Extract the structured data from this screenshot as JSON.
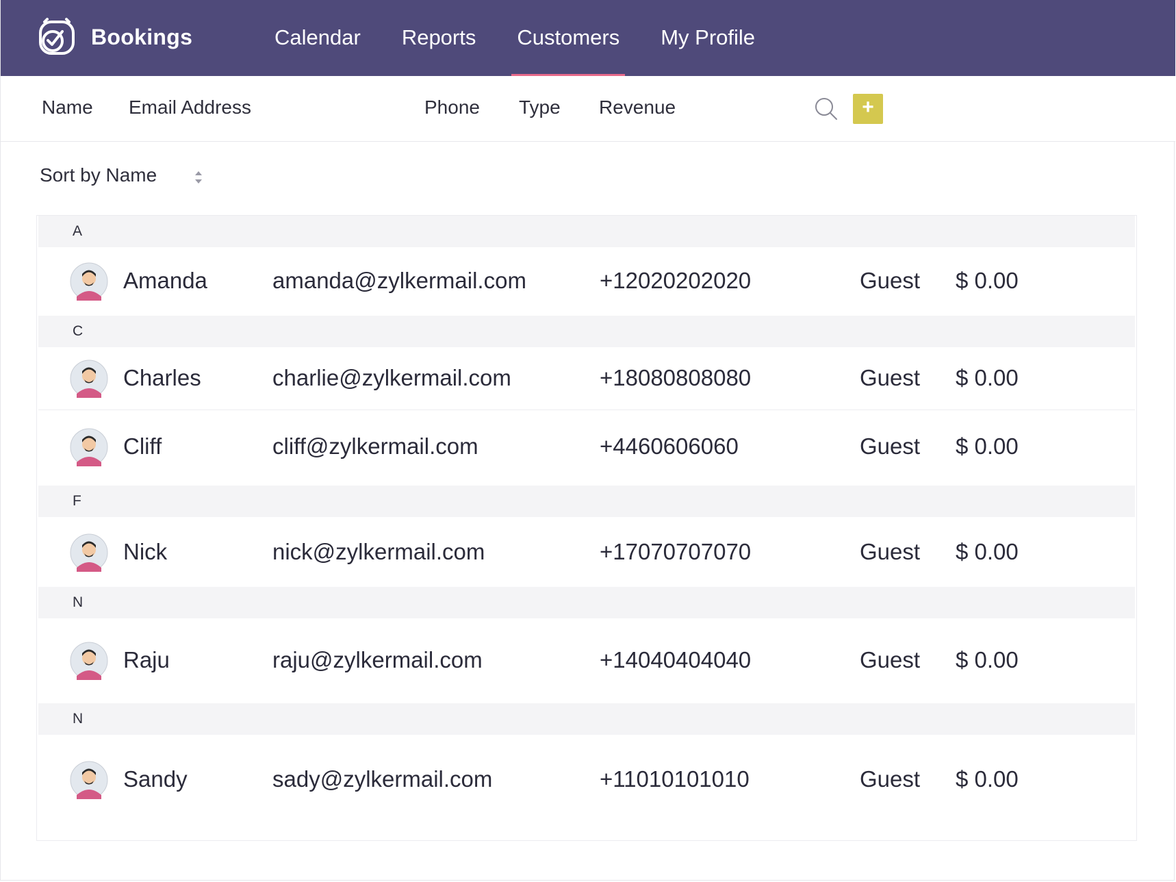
{
  "app": {
    "title": "Bookings"
  },
  "nav": {
    "items": [
      {
        "label": "Calendar"
      },
      {
        "label": "Reports"
      },
      {
        "label": "Customers"
      },
      {
        "label": "My Profile"
      }
    ],
    "active": "Customers"
  },
  "columns": {
    "name": "Name",
    "email": "Email Address",
    "phone": "Phone",
    "type": "Type",
    "revenue": "Revenue"
  },
  "actions": {
    "add_label": "+"
  },
  "sort": {
    "label": "Sort  by Name"
  },
  "groups": [
    {
      "letter": "A",
      "customers": [
        {
          "name": "Amanda",
          "email": "amanda@zylkermail.com",
          "phone": "+12020202020",
          "type": "Guest",
          "revenue": "$ 0.00"
        }
      ]
    },
    {
      "letter": "C",
      "customers": [
        {
          "name": "Charles",
          "email": "charlie@zylkermail.com",
          "phone": "+18080808080",
          "type": "Guest",
          "revenue": "$ 0.00"
        },
        {
          "name": "Cliff",
          "email": "cliff@zylkermail.com",
          "phone": "+4460606060",
          "type": "Guest",
          "revenue": "$ 0.00"
        }
      ]
    },
    {
      "letter": "F",
      "customers": [
        {
          "name": "Nick",
          "email": "nick@zylkermail.com",
          "phone": "+17070707070",
          "type": "Guest",
          "revenue": "$ 0.00"
        }
      ]
    },
    {
      "letter": "N",
      "customers": [
        {
          "name": "Raju",
          "email": "raju@zylkermail.com",
          "phone": "+14040404040",
          "type": "Guest",
          "revenue": "$ 0.00"
        }
      ]
    },
    {
      "letter": "N",
      "customers": [
        {
          "name": "Sandy",
          "email": "sady@zylkermail.com",
          "phone": "+11010101010",
          "type": "Guest",
          "revenue": "$ 0.00"
        }
      ]
    }
  ],
  "colors": {
    "nav_bg": "#4f4a7a",
    "active_underline": "#e76a8a",
    "add_button": "#d4c84f",
    "group_bg": "#f4f4f6"
  }
}
